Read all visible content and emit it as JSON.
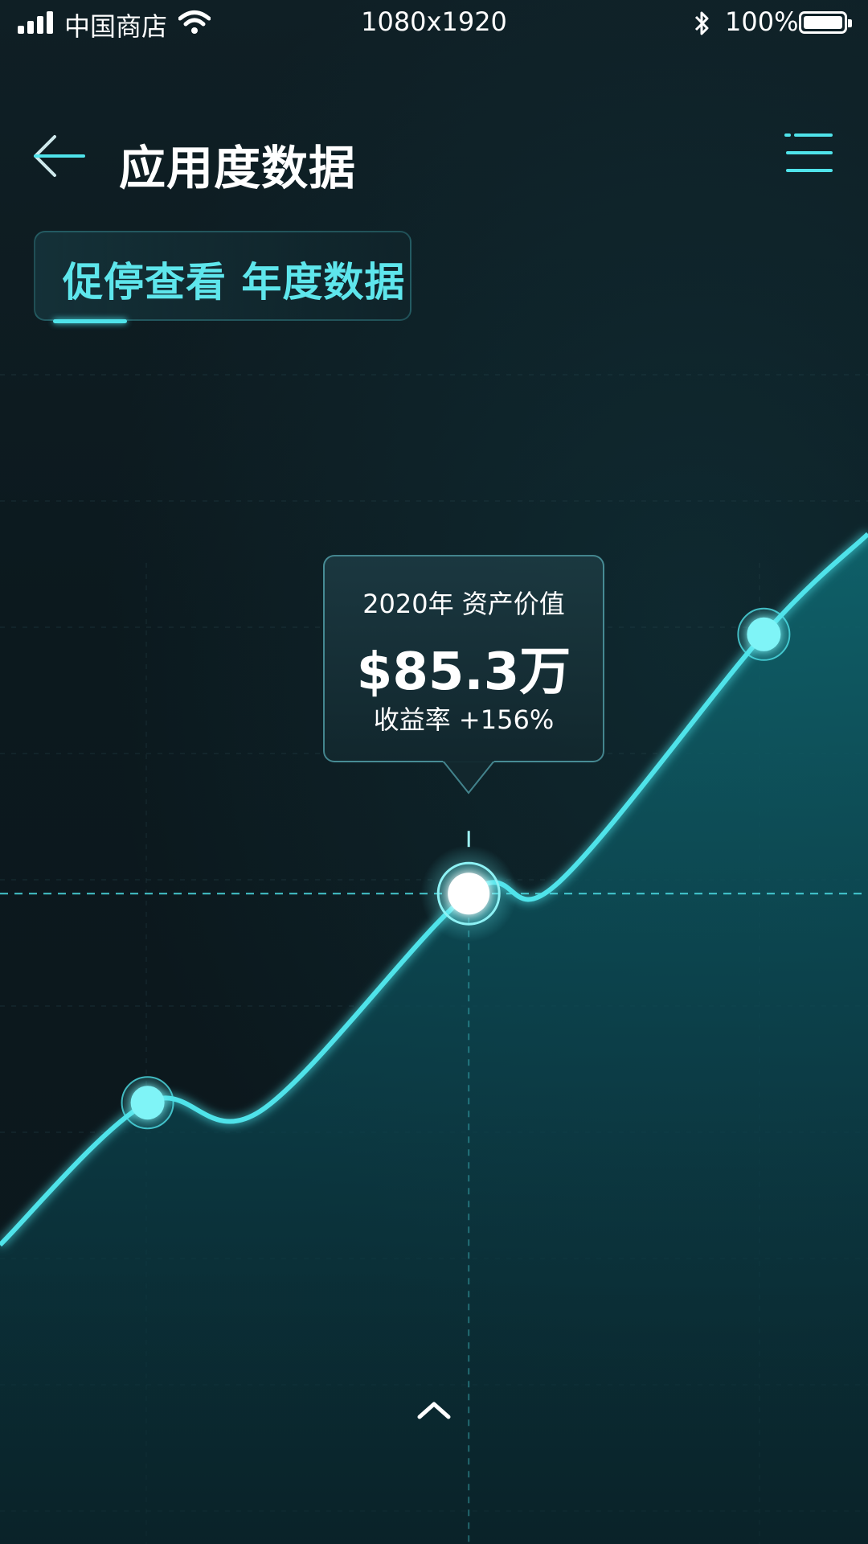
{
  "status_bar": {
    "carrier": "中国商店",
    "resolution": "1080x1920",
    "battery": "100%",
    "battery_level": 1.0
  },
  "header": {
    "title": "应用度数据",
    "back_icon": "arrow-left-icon",
    "menu_icon": "menu-icon"
  },
  "tab": {
    "label": "促停查看 年度数据"
  },
  "tooltip": {
    "year_label": "2020年 资产价值",
    "value": "$85.3万",
    "rate": "收益率 +156%"
  },
  "colors": {
    "accent": "#4fe3ea",
    "background": "#0d1a1f",
    "area_fill": "#0e5560",
    "text": "#ffffff"
  },
  "scroll": {
    "icon": "chevron-up-icon"
  },
  "chart_data": {
    "type": "area",
    "title": "",
    "xlabel": "",
    "ylabel": "",
    "points": [
      {
        "x": 0.0,
        "y": 0.05
      },
      {
        "x": 0.17,
        "y": 0.22,
        "marker": "small"
      },
      {
        "x": 0.3,
        "y": 0.21
      },
      {
        "x": 0.54,
        "y": 0.47,
        "marker": "selected"
      },
      {
        "x": 0.64,
        "y": 0.48
      },
      {
        "x": 0.88,
        "y": 0.78,
        "marker": "small"
      },
      {
        "x": 1.0,
        "y": 0.9
      }
    ],
    "selected_index": 3,
    "grid": true
  }
}
